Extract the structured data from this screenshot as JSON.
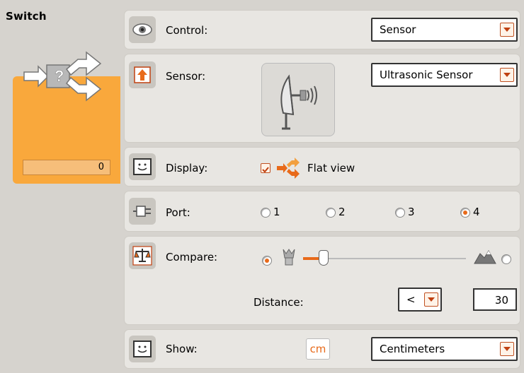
{
  "block": {
    "title": "Switch",
    "counter_value": "0"
  },
  "control": {
    "label": "Control:",
    "selected": "Sensor"
  },
  "sensor": {
    "label": "Sensor:",
    "selected": "Ultrasonic Sensor"
  },
  "display": {
    "label": "Display:",
    "flat_view_label": "Flat view",
    "flat_view_checked": true
  },
  "port": {
    "label": "Port:",
    "options": [
      "1",
      "2",
      "3",
      "4"
    ],
    "selected": "4"
  },
  "compare": {
    "label": "Compare:",
    "selected_side": "near",
    "distance_label": "Distance:",
    "operator": "<",
    "distance_value": "30",
    "slider_fraction": 0.1
  },
  "show": {
    "label": "Show:",
    "unit_badge": "cm",
    "selected": "Centimeters"
  },
  "colors": {
    "accent": "#e86a1a",
    "block_orange": "#f9a83c",
    "panel_bg": "#d6d3ce",
    "row_bg": "#e8e6e2"
  }
}
